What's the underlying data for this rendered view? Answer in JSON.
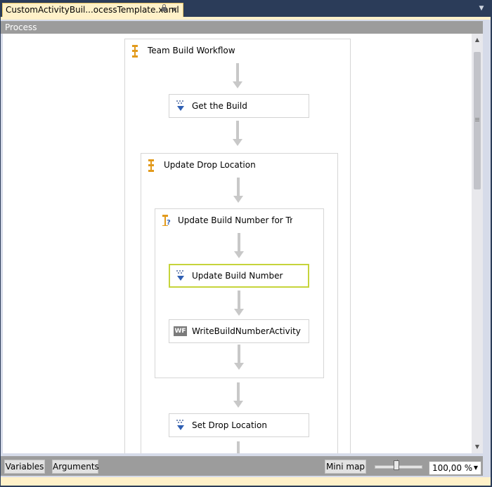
{
  "document_tab": {
    "title": "CustomActivityBuil...ocessTemplate.xaml",
    "close_glyph": "×"
  },
  "breadcrumb": {
    "label": "Process"
  },
  "workflow": {
    "root_sequence": "Team Build Workflow",
    "get_build": "Get the Build",
    "update_drop_location": "Update Drop Location",
    "trigger_if": "Update Build Number for Trigg",
    "update_build_number": "Update Build Number",
    "custom_activity": "WriteBuildNumberActivity",
    "custom_activity_badge": "WF",
    "set_drop_location": "Set Drop Location"
  },
  "bottom_bar": {
    "variables": "Variables",
    "arguments": "Arguments",
    "mini_map": "Mini map",
    "zoom_value": "100,00 %"
  },
  "colors": {
    "chrome_dark": "#2b3c59",
    "tab_gold": "#fff1c9",
    "selection": "#c6d43b",
    "connector": "#c8c8c8",
    "bar_gray": "#9c9c9c"
  },
  "icons": {
    "sequence": "sequence-icon",
    "assign": "assign-activity-icon",
    "if": "if-activity-icon",
    "custom": "wf-activity-icon"
  }
}
